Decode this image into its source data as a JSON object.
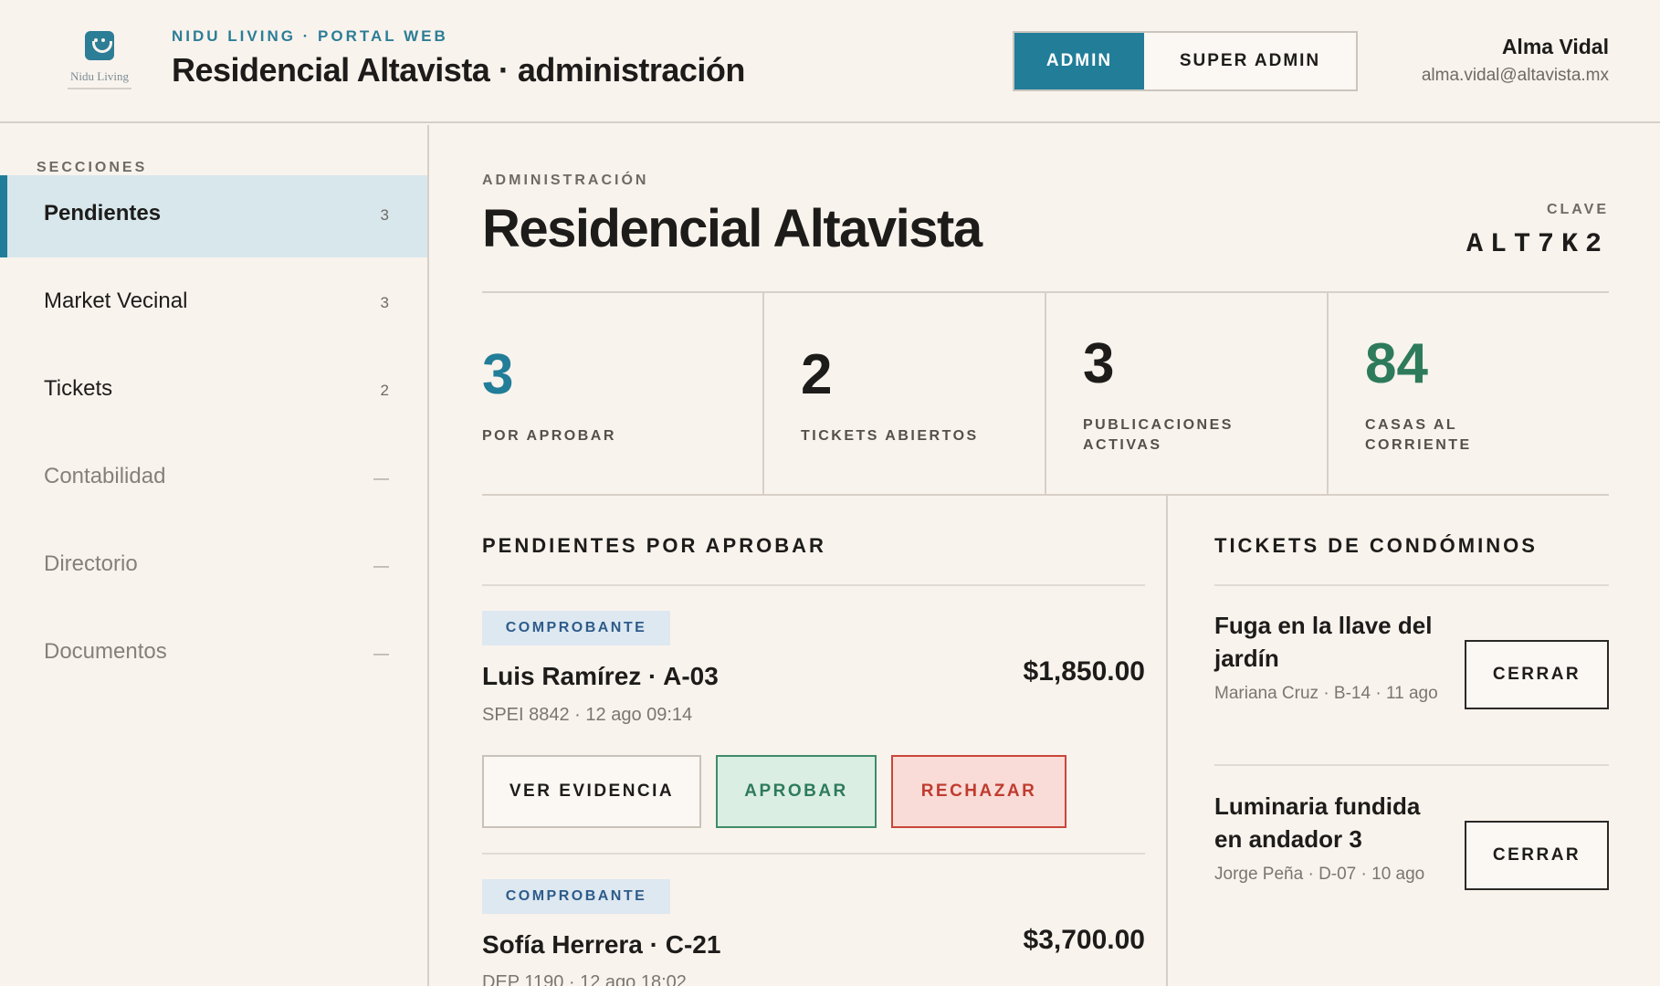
{
  "header": {
    "logo_text": "Nidu Living",
    "eyebrow": "NIDU LIVING · PORTAL WEB",
    "title": "Residencial Altavista · administración",
    "roles": {
      "admin": "ADMIN",
      "super_admin": "SUPER ADMIN",
      "active": "ADMIN"
    },
    "user": {
      "name": "Alma Vidal",
      "email": "alma.vidal@altavista.mx"
    }
  },
  "sidebar": {
    "heading": "SECCIONES",
    "items": [
      {
        "label": "Pendientes",
        "count": "3",
        "active": true
      },
      {
        "label": "Market Vecinal",
        "count": "3"
      },
      {
        "label": "Tickets",
        "count": "2"
      },
      {
        "label": "Contabilidad",
        "count": "—"
      },
      {
        "label": "Directorio",
        "count": "—"
      },
      {
        "label": "Documentos",
        "count": "—"
      }
    ]
  },
  "main": {
    "crumb": "ADMINISTRACIÓN",
    "title": "Residencial Altavista",
    "clave_label": "CLAVE",
    "clave": "ALT7K2",
    "stats": [
      {
        "value": "3",
        "label": "POR APROBAR",
        "color": "#217d98"
      },
      {
        "value": "2",
        "label": "TICKETS ABIERTOS",
        "color": "#1d1c1a"
      },
      {
        "value": "3",
        "label": "PUBLICACIONES ACTIVAS",
        "color": "#1d1c1a"
      },
      {
        "value": "84",
        "label": "CASAS AL CORRIENTE",
        "color": "#2d7b5a"
      }
    ],
    "pending": {
      "heading": "PENDIENTES POR APROBAR",
      "items": [
        {
          "tag": "COMPROBANTE",
          "name": "Luis Ramírez · A-03",
          "amount": "$1,850.00",
          "meta": "SPEI 8842 · 12 ago 09:14",
          "actions": {
            "evidence": "VER EVIDENCIA",
            "approve": "APROBAR",
            "reject": "RECHAZAR"
          }
        },
        {
          "tag": "COMPROBANTE",
          "name": "Sofía Herrera · C-21",
          "amount": "$3,700.00",
          "meta": "DEP 1190 · 12 ago 18:02"
        }
      ]
    },
    "tickets": {
      "heading": "TICKETS DE CONDÓMINOS",
      "items": [
        {
          "title": "Fuga en la llave del jardín",
          "meta": "Mariana Cruz · B-14 · 11 ago",
          "action": "CERRAR"
        },
        {
          "title": "Luminaria fundida en andador 3",
          "meta": "Jorge Peña · D-07 · 10 ago",
          "action": "CERRAR"
        }
      ]
    }
  }
}
